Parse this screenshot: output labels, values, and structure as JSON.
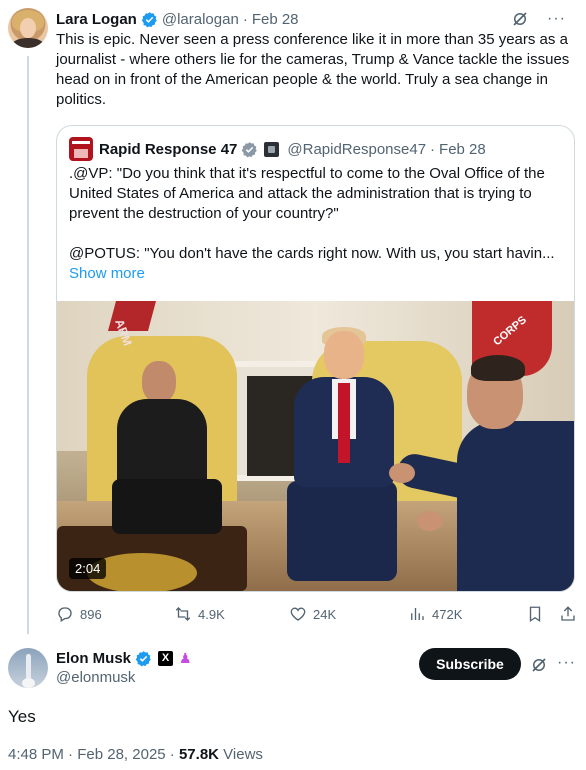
{
  "tweet": {
    "author_name": "Lara Logan",
    "author_handle": "@laralogan",
    "separator": "·",
    "date": "Feb 28",
    "text": "This is epic. Never seen a press conference like it in more than 35 years as a journalist - where others lie for the cameras, Trump & Vance tackle the issues head on in front of the American people & the world. Truly a sea change in politics.",
    "more_glyph": "···"
  },
  "quote": {
    "author_name": "Rapid Response 47",
    "author_handle": "@RapidResponse47",
    "separator": "·",
    "date": "Feb 28",
    "paragraph1": ".@VP: \"Do you think that it's respectful to come to the Oval Office of the United States of America and attack the administration that is trying to prevent the destruction of your country?\"",
    "paragraph2": "@POTUS: \"You don't have the cards right now. With us, you start havin...",
    "show_more": "Show more",
    "video_duration": "2:04",
    "video_text_left": "ARM",
    "video_text_right": "CORPS"
  },
  "actions": {
    "replies": "896",
    "reposts": "4.9K",
    "likes": "24K",
    "views": "472K"
  },
  "reply": {
    "author_name": "Elon Musk",
    "author_handle": "@elonmusk",
    "x_badge": "X",
    "subscribe_label": "Subscribe",
    "text": "Yes",
    "more_glyph": "···",
    "time": "4:48 PM",
    "separator": "·",
    "date": "Feb 28, 2025",
    "views_count": "57.8K",
    "views_label": "Views"
  },
  "colors": {
    "verified_blue": "#1d9bf0",
    "text_primary": "#0f1419",
    "text_secondary": "#536471",
    "link": "#1d9bf0",
    "border": "#cfd9de"
  },
  "icons": [
    "verified-badge-icon",
    "grok-icon",
    "more-icon",
    "government-badge-icon",
    "reply-icon",
    "repost-icon",
    "like-icon",
    "views-icon",
    "bookmark-icon",
    "share-icon",
    "x-badge-icon",
    "affiliate-badge-icon"
  ]
}
